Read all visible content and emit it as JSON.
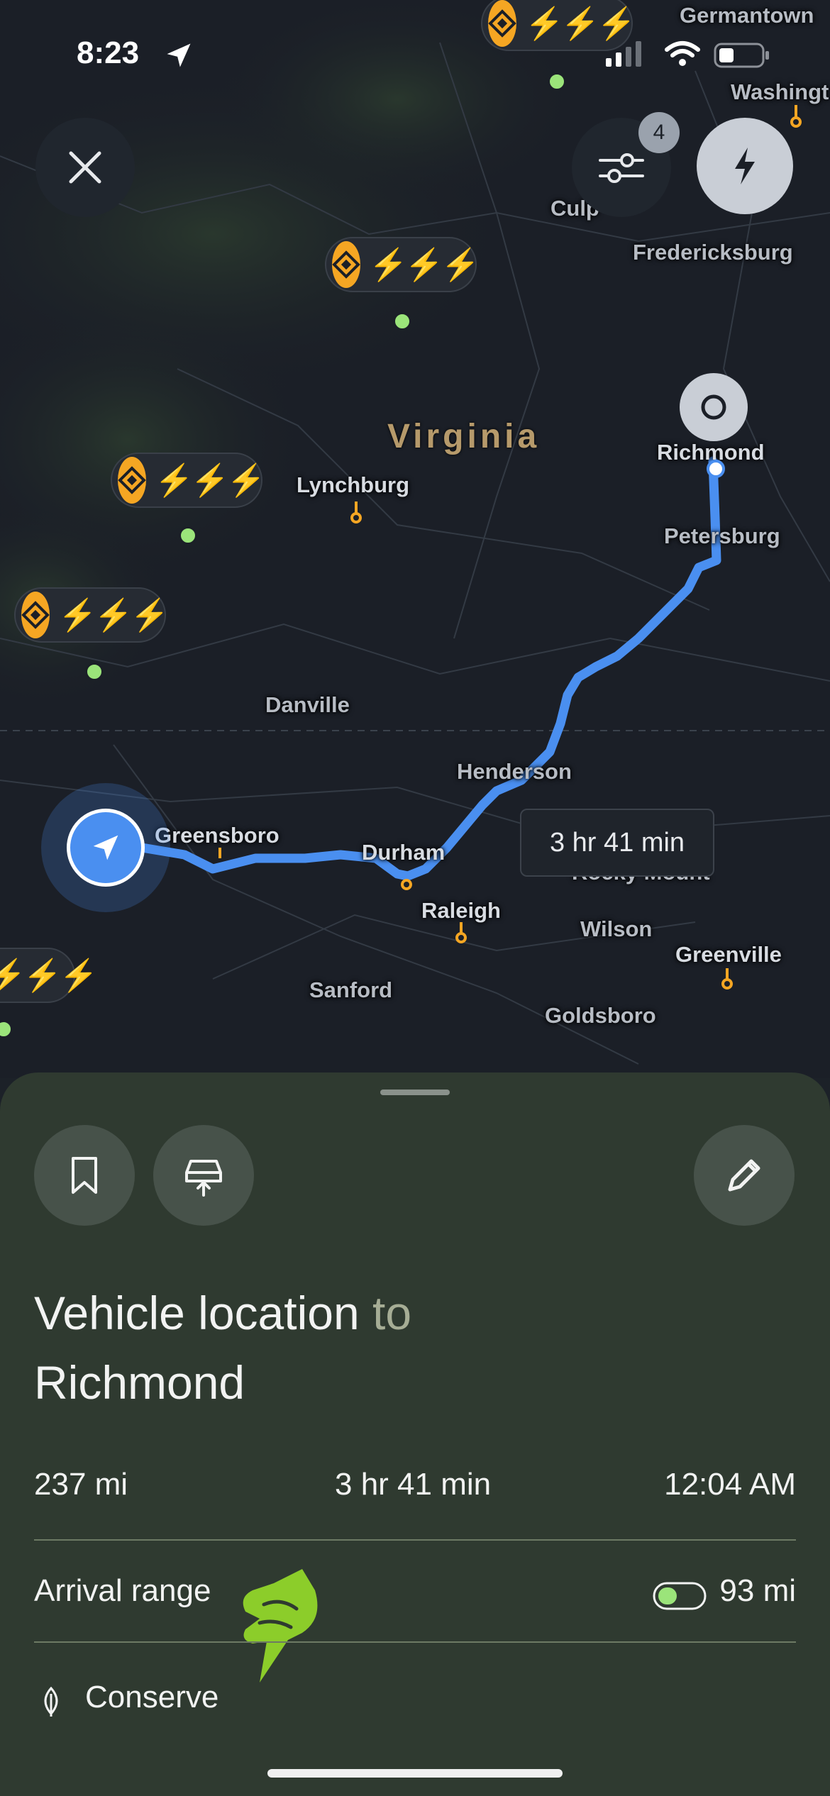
{
  "status_bar": {
    "time": "8:23"
  },
  "map": {
    "region_label": "Virginia",
    "cities": [
      {
        "name": "Germantown"
      },
      {
        "name": "Washingt"
      },
      {
        "name": "Fredericksburg"
      },
      {
        "name": "Culp"
      },
      {
        "name": "Richmond"
      },
      {
        "name": "Petersburg"
      },
      {
        "name": "Lynchburg"
      },
      {
        "name": "Danville"
      },
      {
        "name": "Henderson"
      },
      {
        "name": "Greensboro"
      },
      {
        "name": "Durham"
      },
      {
        "name": "Raleigh"
      },
      {
        "name": "Rocky Mount"
      },
      {
        "name": "Wilson"
      },
      {
        "name": "Greenville"
      },
      {
        "name": "Sanford"
      },
      {
        "name": "Goldsboro"
      }
    ],
    "filter_badge_count": "4",
    "route_duration": "3 hr 41 min"
  },
  "sheet": {
    "origin": "Vehicle location",
    "connector": "to",
    "destination": "Richmond",
    "distance": "237 mi",
    "duration": "3 hr 41 min",
    "arrival_time": "12:04 AM",
    "arrival_range_label": "Arrival range",
    "arrival_range_value": "93 mi",
    "mode_label": "Conserve"
  },
  "colors": {
    "route": "#4a8ff0",
    "charger": "#f5a623",
    "bolt": "#4cc23a",
    "sheet": "#2f3a30"
  }
}
